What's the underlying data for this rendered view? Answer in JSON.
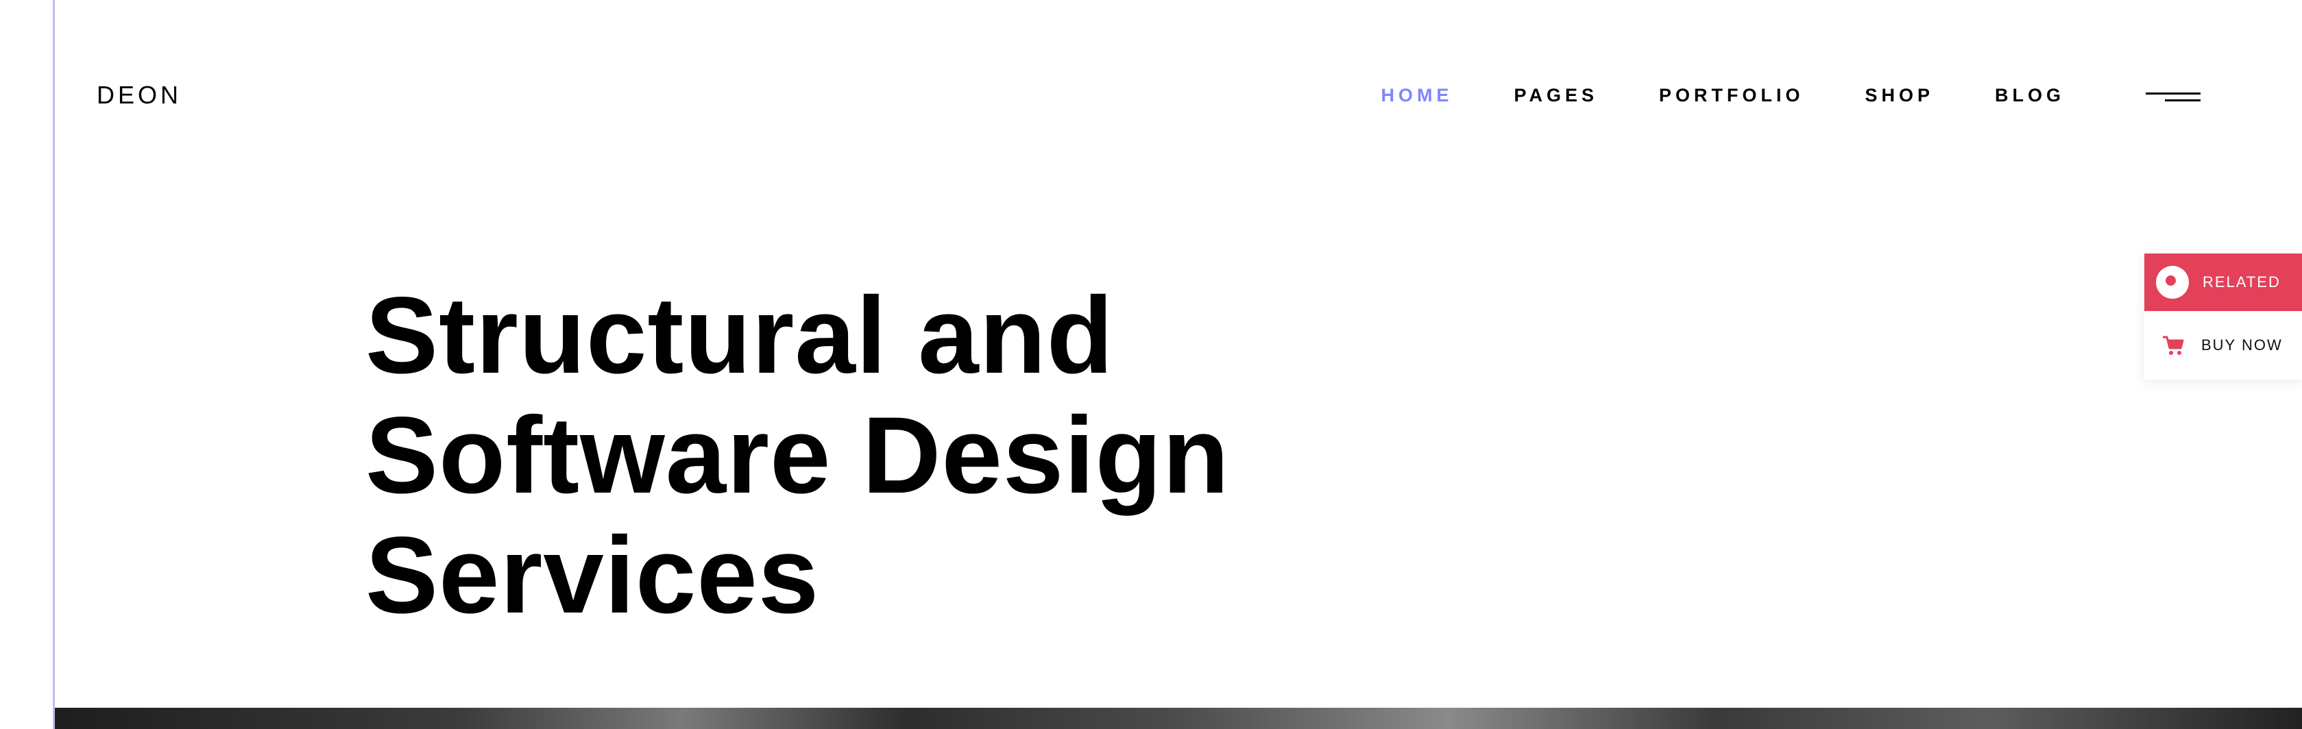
{
  "brand": {
    "logo": "DEON"
  },
  "nav": {
    "items": [
      {
        "label": "HOME",
        "active": true
      },
      {
        "label": "PAGES",
        "active": false
      },
      {
        "label": "PORTFOLIO",
        "active": false
      },
      {
        "label": "SHOP",
        "active": false
      },
      {
        "label": "BLOG",
        "active": false
      }
    ],
    "menu_icon": "hamburger-menu-icon"
  },
  "hero": {
    "lines": [
      "Structural and",
      "Software Design",
      "Services"
    ]
  },
  "side_widget": {
    "related_label": "RELATED",
    "related_icon": "related-icon",
    "buy_label": "BUY NOW",
    "buy_icon": "cart-icon"
  },
  "colors": {
    "accent_nav": "#7d86ff",
    "related_bg": "#e3405a",
    "line": "#c9b8ee"
  }
}
